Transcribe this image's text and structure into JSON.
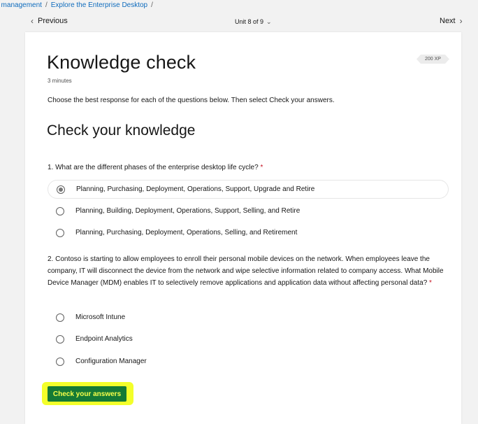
{
  "breadcrumb": {
    "items": [
      "t management",
      "Explore the Enterprise Desktop"
    ],
    "separator": "/"
  },
  "nav": {
    "previous_label": "Previous",
    "unit_label": "Unit 8 of 9",
    "next_label": "Next"
  },
  "page": {
    "title": "Knowledge check",
    "duration": "3 minutes",
    "xp": "200 XP",
    "intro_text": "Choose the best response for each of the questions below. Then select ",
    "intro_bold": "Check your answers",
    "intro_end": ".",
    "subtitle": "Check your knowledge"
  },
  "questions": [
    {
      "text": "1. What are the different phases of the enterprise desktop life cycle?",
      "required_mark": "*",
      "selected_index": 0,
      "options": [
        "Planning, Purchasing, Deployment, Operations, Support, Upgrade and Retire",
        "Planning, Building, Deployment, Operations, Support, Selling, and Retire",
        "Planning, Purchasing, Deployment, Operations, Selling, and Retirement"
      ]
    },
    {
      "text": "2. Contoso is starting to allow employees to enroll their personal mobile devices on the network. When employees leave the company, IT will disconnect the device from the network and wipe selective information related to company access. What Mobile Device Manager (MDM) enables IT to selectively remove applications and application data without affecting personal data?",
      "required_mark": "*",
      "selected_index": null,
      "options": [
        "Microsoft Intune",
        "Endpoint Analytics",
        "Configuration Manager"
      ]
    }
  ],
  "actions": {
    "submit_label": "Check your answers"
  },
  "colors": {
    "link": "#0f6cbd",
    "submit_bg": "#157a35",
    "submit_text": "#f7ff4a",
    "highlight": "#f3ff2a",
    "required": "#c50f1f"
  }
}
